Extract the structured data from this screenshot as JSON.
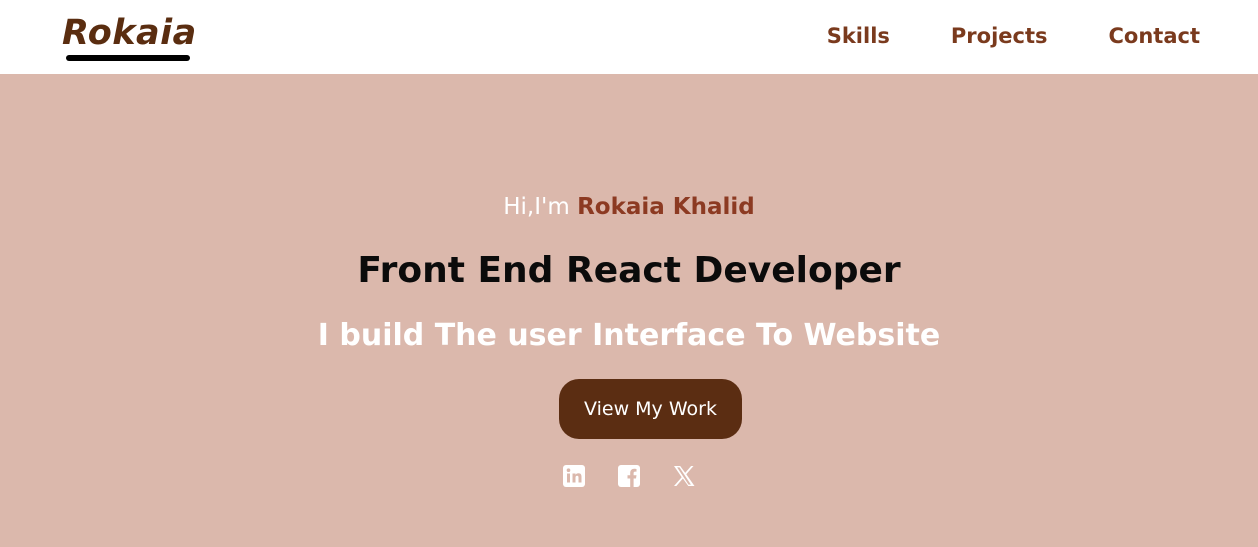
{
  "nav": {
    "logo": "Rokaia",
    "links": [
      {
        "label": "Skills"
      },
      {
        "label": "Projects"
      },
      {
        "label": "Contact"
      }
    ]
  },
  "hero": {
    "greeting_prefix": "Hi,I'm",
    "name": "Rokaia Khalid",
    "role": "Front End React Developer",
    "tagline": "I build The user Interface To Website",
    "cta_label": "View My Work",
    "socials": [
      {
        "icon": "linkedin-icon"
      },
      {
        "icon": "facebook-icon"
      },
      {
        "icon": "x-twitter-icon"
      }
    ]
  },
  "colors": {
    "brand_dark": "#5b2d12",
    "accent": "#8c3a22",
    "hero_bg": "#dbb8ac",
    "white": "#ffffff"
  }
}
